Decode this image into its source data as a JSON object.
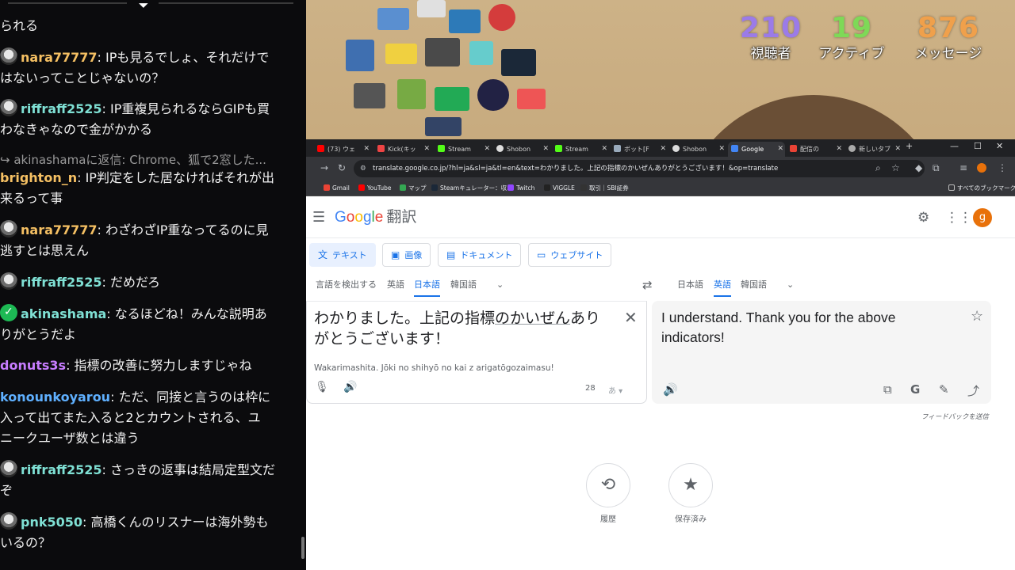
{
  "chat": {
    "top_fragment": "られる",
    "messages": [
      {
        "user": "nara77777",
        "color": "#f5c063",
        "text": "IPも見るでしょ、それだけではないってことじゃないの？",
        "lines": [
          "IPも見るでしょ、それだけで",
          "はないってことじゃないの？"
        ]
      },
      {
        "user": "riffraff2525",
        "color": "#7fe0d4",
        "text": "IP重複見られるならGIPも買わなきゃなので金がかかる",
        "lines": [
          "IP重複見られるならGIPも買",
          "わなきゃなので金がかかる"
        ]
      },
      {
        "reply": "akinashamaに返信: Chrome、狐で2窓した..."
      },
      {
        "user": "brighton_n",
        "color": "#f5c063",
        "text": "IP判定をした居なければそれが出来るって事",
        "lines": [
          "IP判定をした居なければそれが出",
          "来るって事"
        ]
      },
      {
        "user": "nara77777",
        "color": "#f5c063",
        "lines": [
          "わざわざIP重なってるのに見",
          "逃すとは思えん"
        ]
      },
      {
        "user": "riffraff2525",
        "color": "#7fe0d4",
        "lines": [
          "だめだろ"
        ]
      },
      {
        "user": "akinashama",
        "color": "#7fe0d4",
        "verified": true,
        "lines": [
          "なるほどね！みんな説明あ",
          "りがとうだよ"
        ]
      },
      {
        "user": "donuts3s",
        "color": "#c77dff",
        "lines": [
          "指標の改善に努力しますじゃね"
        ]
      },
      {
        "user": "konounkoyarou",
        "color": "#5fb0ff",
        "lines": [
          "ただ、同接と言うのは枠に",
          "入って出てまた入ると2とカウントされる、ユ",
          "ニークユーザ数とは違う"
        ]
      },
      {
        "user": "riffraff2525",
        "color": "#7fe0d4",
        "lines": [
          "さっきの返事は結局定型文だ",
          "ぞ"
        ]
      },
      {
        "user": "pnk5050",
        "color": "#7fe0d4",
        "lines": [
          "高橋くんのリスナーは海外勢も",
          "いるの？"
        ]
      }
    ]
  },
  "stats": [
    {
      "value": "210",
      "label": "視聴者",
      "color": "#9b7be8"
    },
    {
      "value": "19",
      "label": "アクティブ",
      "color": "#7ed957"
    },
    {
      "value": "876",
      "label": "メッセージ",
      "color": "#f0a04b"
    }
  ],
  "browser": {
    "tabs": [
      {
        "label": "(73) ウェ",
        "color": "#ff0000"
      },
      {
        "label": "Kick(キッ",
        "color": "#e44"
      },
      {
        "label": "Stream",
        "color": "#53fc18"
      },
      {
        "label": "Shobon",
        "color": "#ddd"
      },
      {
        "label": "Stream",
        "color": "#53fc18"
      },
      {
        "label": "ボット[F",
        "color": "#9ab"
      },
      {
        "label": "Shobon",
        "color": "#ddd"
      },
      {
        "label": "Google",
        "color": "#4285f4",
        "active": true
      },
      {
        "label": "配信の",
        "color": "#ea4335"
      },
      {
        "label": "新しいタブ",
        "color": "#aaa"
      }
    ],
    "url": "translate.google.co.jp/?hl=ja&sl=ja&tl=en&text=わかりました。上記の指標のかいぜんありがとうございます！&op=translate",
    "bookmarks": [
      {
        "label": "Gmail",
        "color": "#ea4335"
      },
      {
        "label": "YouTube",
        "color": "#ff0000"
      },
      {
        "label": "マップ",
        "color": "#34a853"
      },
      {
        "label": "Steamキュレーター：収...",
        "color": "#1b2838"
      },
      {
        "label": "Twitch",
        "color": "#9146ff"
      },
      {
        "label": "VIGGLE",
        "color": "#222"
      },
      {
        "label": "取引｜SBI証券",
        "color": "#333"
      }
    ],
    "bookmarks_all": "すべてのブックマーク"
  },
  "translate": {
    "title": "翻訳",
    "account_initial": "g",
    "modes": [
      "テキスト",
      "画像",
      "ドキュメント",
      "ウェブサイト"
    ],
    "source_langs": [
      "言語を検出する",
      "英語",
      "日本語",
      "韓国語"
    ],
    "target_langs": [
      "日本語",
      "英語",
      "韓国語"
    ],
    "source_text_parts": [
      "わかりました。上記の指標",
      "のかいぜん",
      "ありがとうございます！"
    ],
    "romanization": "Wakarimashita. Jōki no shihyō no kai z arigatōgozaimasu!",
    "char_count": "28",
    "ime": "あ",
    "target_text": "I understand. Thank you for the above indicators!",
    "feedback": "フィードバックを送信",
    "history": "履歴",
    "saved": "保存済み"
  }
}
